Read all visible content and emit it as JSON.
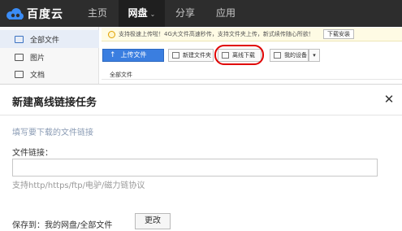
{
  "brand": {
    "name": "百度云"
  },
  "nav": {
    "items": [
      {
        "label": "主页"
      },
      {
        "label": "网盘",
        "active": true
      },
      {
        "label": "分享"
      },
      {
        "label": "应用"
      }
    ],
    "active_chevron": "⌄"
  },
  "sidebar": {
    "items": [
      {
        "label": "全部文件",
        "icon": "folder-icon",
        "active": true
      },
      {
        "label": "图片",
        "icon": "image-icon"
      },
      {
        "label": "文档",
        "icon": "document-icon"
      }
    ]
  },
  "notice": {
    "text": "支持极速上传啦！4G大文件高速秒传，支持文件夹上传，新式续传随心所欲！",
    "button_label": "下载安装"
  },
  "toolbar": {
    "upload_label": "上传文件",
    "new_folder_label": "新建文件夹",
    "offline_download_label": "离线下载",
    "my_devices_label": "我的设备",
    "dropdown_caret": "▾"
  },
  "breadcrumb": {
    "text": "全部文件"
  },
  "dialog": {
    "title": "新建离线链接任务",
    "close_symbol": "✕",
    "hint": "填写要下载的文件链接",
    "link_label": "文件链接：",
    "link_value": "",
    "protocols_hint": "支持http/https/ftp/电驴/磁力链协议",
    "save_to_label": "保存到：我的网盘/全部文件",
    "change_button_label": "更改"
  },
  "colors": {
    "topbar": "#2d2d2d",
    "upload_button": "#3a7ee0",
    "highlight_ring": "#e00000",
    "hint_text": "#8a9bb4"
  }
}
